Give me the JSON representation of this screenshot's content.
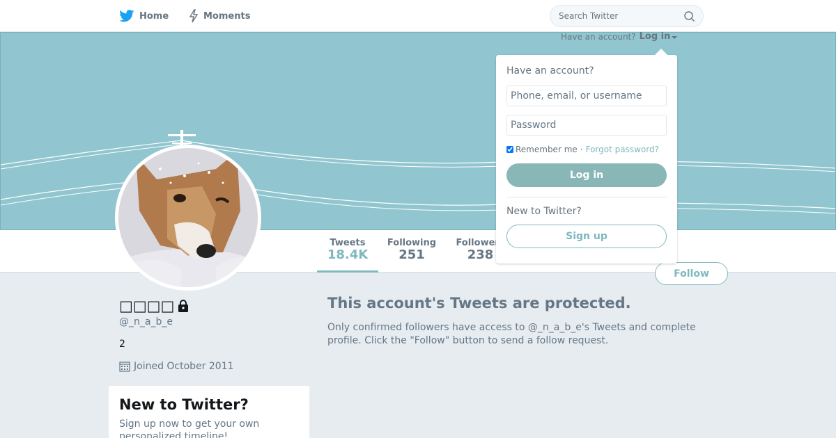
{
  "nav": {
    "home_label": "Home",
    "moments_label": "Moments",
    "search_placeholder": "Search Twitter"
  },
  "account_prompt": {
    "text": "Have an account?",
    "login_label": "Log in"
  },
  "profile": {
    "name": "□□□□",
    "screen_name": "@_n_a_b_e",
    "bio": "2",
    "joined": "Joined October 2011"
  },
  "stats": {
    "tweets_label": "Tweets",
    "tweets_value": "18.4K",
    "following_label": "Following",
    "following_value": "251",
    "followers_label": "Followers",
    "followers_value": "238"
  },
  "follow_label": "Follow",
  "protected": {
    "title": "This account's Tweets are protected.",
    "body": "Only confirmed followers have access to @_n_a_b_e's Tweets and complete profile. Click the \"Follow\" button to send a follow request."
  },
  "signup_card": {
    "title": "New to Twitter?",
    "text": "Sign up now to get your own personalized timeline!"
  },
  "login_dropdown": {
    "title": "Have an account?",
    "username_placeholder": "Phone, email, or username",
    "password_placeholder": "Password",
    "remember_label": "Remember me",
    "separator": "·",
    "forgot_label": "Forgot password?",
    "login_button": "Log in",
    "new_label": "New to Twitter?",
    "signup_button": "Sign up"
  },
  "colors": {
    "banner": "#91c6d0",
    "accent": "#7fb8bf",
    "twitter_blue": "#1da1f2"
  }
}
